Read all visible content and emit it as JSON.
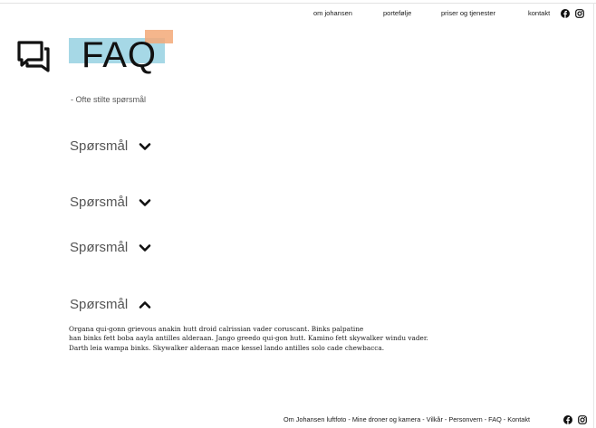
{
  "nav": {
    "items": [
      "om johansen",
      "portefølje",
      "priser og tjenester",
      "kontakt"
    ],
    "social": [
      "facebook-icon",
      "instagram-icon"
    ]
  },
  "hero": {
    "title": "FAQ",
    "subtitle": "- Ofte stilte spørsmål",
    "icon": "chat-bubbles-icon",
    "colors": {
      "blue_block": "#a6d8e6",
      "orange_block": "#f3a978"
    }
  },
  "faq": {
    "questions": [
      {
        "label": "Spørsmål",
        "expanded": false
      },
      {
        "label": "Spørsmål",
        "expanded": false
      },
      {
        "label": "Spørsmål",
        "expanded": false
      },
      {
        "label": "Spørsmål",
        "expanded": true
      }
    ],
    "answer_lines": [
      "Organa qui-gonn grievous anakin hutt droid calrissian vader coruscant. Binks palpatine",
      " han binks fett boba aayla antilles alderaan. Jango greedo qui-gon hutt. Kamino fett skywalker  windu vader.",
      "Darth leia wampa binks. Skywalker alderaan mace kessel lando antilles solo cade chewbacca."
    ]
  },
  "footer": {
    "text": "Om Johansen luftfoto - Mine droner og kamera - Vilkår - Personvern - FAQ - Kontakt"
  }
}
